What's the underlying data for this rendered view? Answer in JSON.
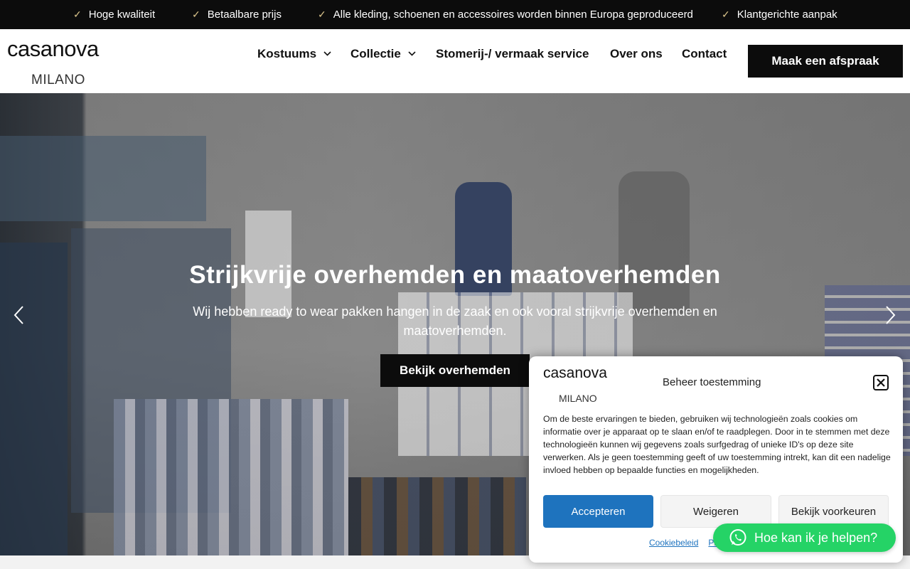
{
  "topbar": {
    "usps": [
      {
        "icon": "check-icon",
        "label": "Hoge kwaliteit"
      },
      {
        "icon": "check-icon",
        "label": "Betaalbare prijs"
      },
      {
        "icon": "check-icon",
        "label": "Alle kleding, schoenen en accessoires worden binnen Europa geproduceerd"
      },
      {
        "icon": "check-icon",
        "label": "Klantgerichte aanpak"
      }
    ]
  },
  "header": {
    "logo_word": "casanova",
    "logo_sub": "MILANO",
    "nav": [
      {
        "label": "Kostuums",
        "has_dropdown": true
      },
      {
        "label": "Collectie",
        "has_dropdown": true
      },
      {
        "label": "Stomerij-/ vermaak service",
        "has_dropdown": false
      },
      {
        "label": "Over ons",
        "has_dropdown": false
      },
      {
        "label": "Contact",
        "has_dropdown": false
      }
    ],
    "cta_label": "Maak een afspraak"
  },
  "hero": {
    "title": "Strijkvrije overhemden en maatoverhemden",
    "subtitle": "Wij hebben ready to wear pakken hangen in de zaak en ook vooral strijkvrije overhemden en maatoverhemden.",
    "button_label": "Bekijk overhemden",
    "prev_icon": "chevron-left-icon",
    "next_icon": "chevron-right-icon"
  },
  "cookie": {
    "logo_word": "casanova",
    "logo_sub": "MILANO",
    "title": "Beheer toestemming",
    "text": "Om de beste ervaringen te bieden, gebruiken wij technologieën zoals cookies om informatie over je apparaat op te slaan en/of te raadplegen. Door in te stemmen met deze technologieën kunnen wij gegevens zoals surfgedrag of unieke ID's op deze site verwerken. Als je geen toestemming geeft of uw toestemming intrekt, kan dit een nadelige invloed hebben op bepaalde functies en mogelijkheden.",
    "accept_label": "Accepteren",
    "deny_label": "Weigeren",
    "prefs_label": "Bekijk voorkeuren",
    "links": [
      "Cookiebeleid",
      "Pr"
    ]
  },
  "whatsapp": {
    "label": "Hoe kan ik je helpen?",
    "icon": "whatsapp-icon"
  },
  "colors": {
    "accent_blue": "#1e73be",
    "whatsapp_green": "#25d366",
    "dark": "#0c0c0c",
    "check_gold": "#d9c38a"
  }
}
